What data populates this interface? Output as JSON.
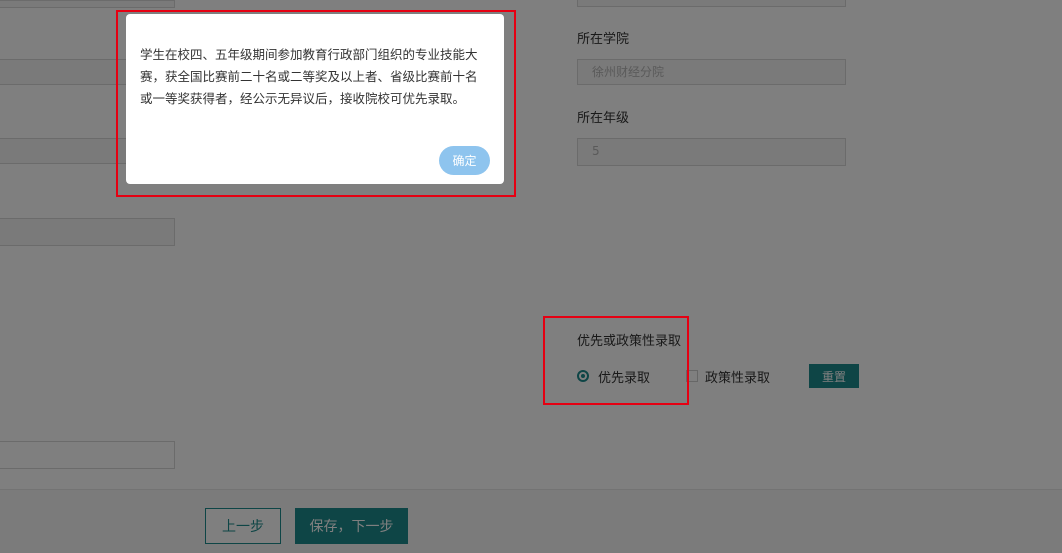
{
  "form": {
    "college_label": "所在学院",
    "college_value": "徐州财经分院",
    "grade_label": "所在年级",
    "grade_value": "5",
    "admission_label": "优先或政策性录取",
    "options": [
      {
        "label": "优先录取",
        "selected": true
      },
      {
        "label": "政策性录取",
        "selected": false
      }
    ],
    "reset_label": "重置"
  },
  "footer": {
    "prev_label": "上一步",
    "next_label": "保存，下一步"
  },
  "dialog": {
    "message": "学生在校四、五年级期间参加教育行政部门组织的专业技能大赛，获全国比赛前二十名或二等奖及以上者、省级比赛前十名或一等奖获得者，经公示无异议后，接收院校可优先录取。",
    "ok_label": "确定"
  },
  "colors": {
    "accent": "#1d8a8c",
    "ok_button": "#8ec4ee",
    "highlight": "#e60012"
  }
}
